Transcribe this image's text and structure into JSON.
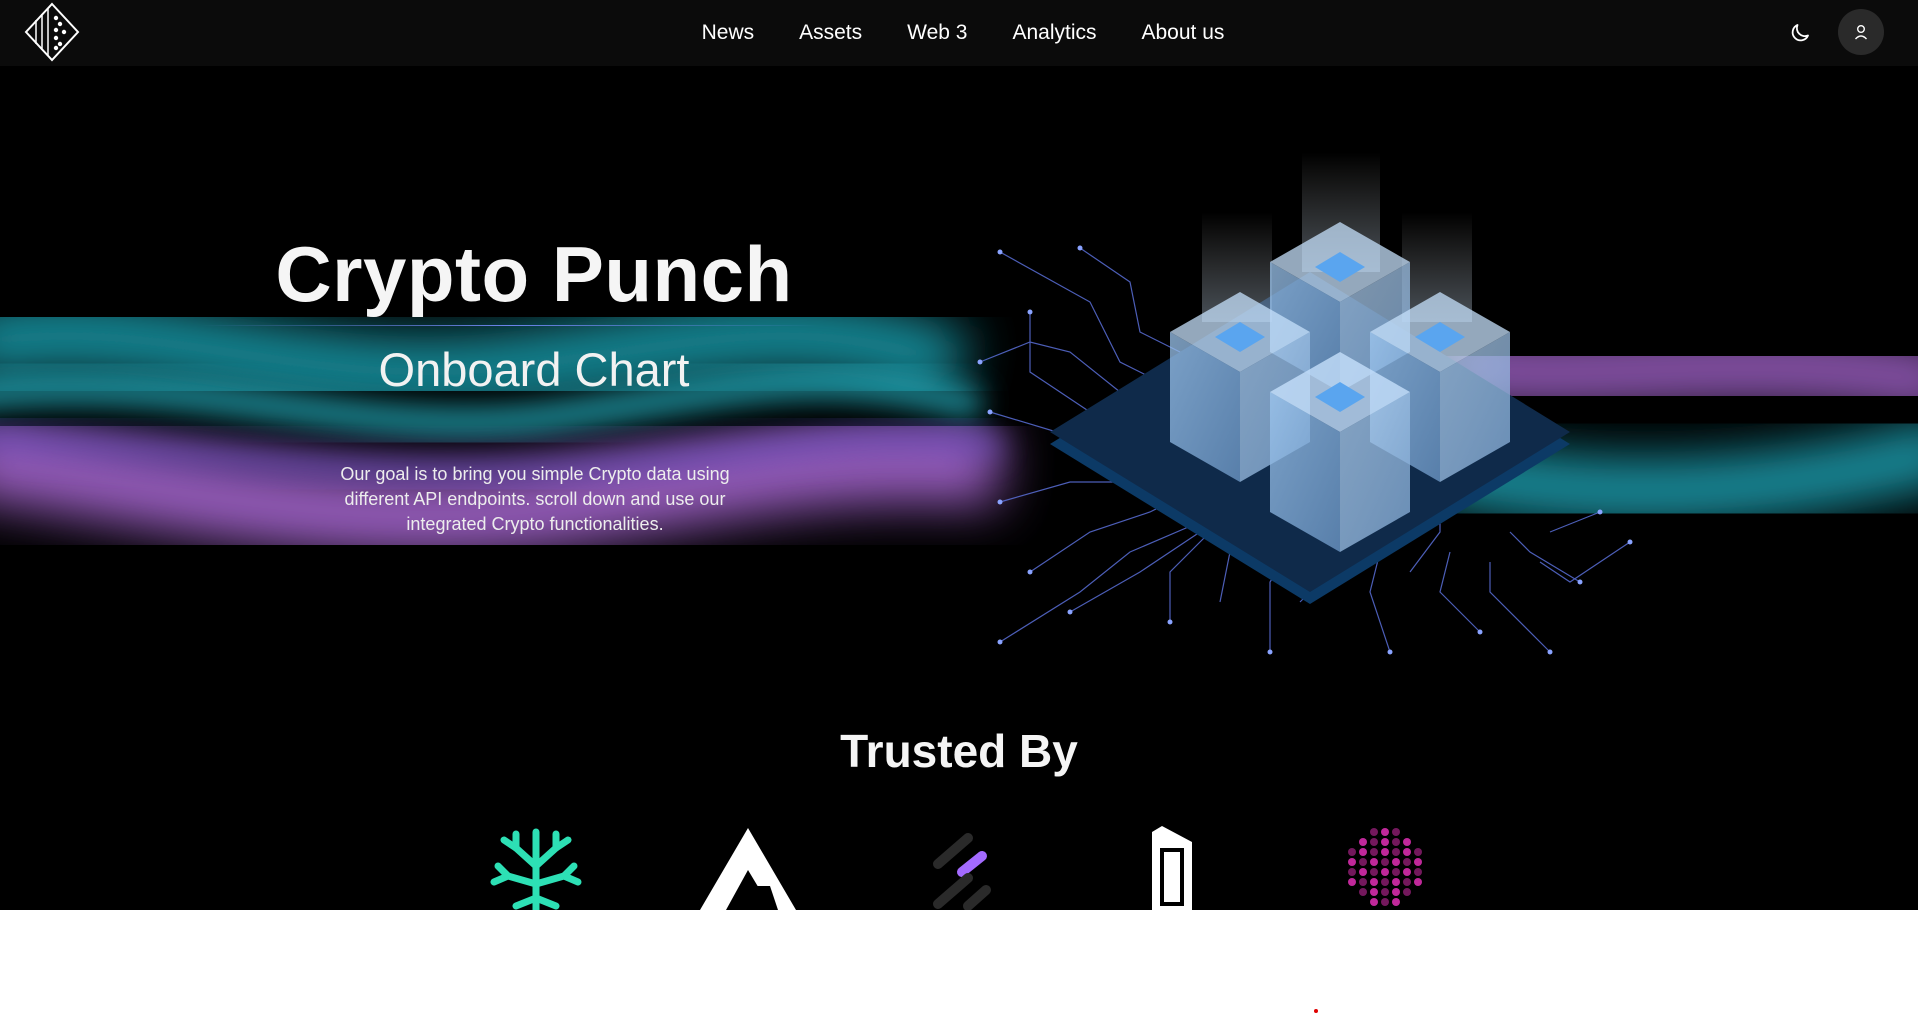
{
  "nav": {
    "items": [
      {
        "label": "News"
      },
      {
        "label": "Assets"
      },
      {
        "label": "Web 3"
      },
      {
        "label": "Analytics"
      },
      {
        "label": "About us"
      }
    ],
    "theme_icon": "moon-icon",
    "user_icon": "user-icon",
    "logo_icon": "diamond-logo-icon"
  },
  "hero": {
    "title": "Crypto Punch",
    "subtitle": "Onboard Chart",
    "description": "Our goal is to bring you simple Crypto data using different API endpoints. scroll down and use our integrated Crypto functionalities."
  },
  "trusted": {
    "heading": "Trusted By",
    "brands": [
      {
        "icon": "snowflake-tree-icon",
        "color": "#2de0b5"
      },
      {
        "icon": "mountain-a-icon",
        "color": "#ffffff"
      },
      {
        "icon": "slashes-icon",
        "color": "#a46bff"
      },
      {
        "icon": "book-card-icon",
        "color": "#ffffff"
      },
      {
        "icon": "hexagon-dots-icon",
        "color": "#c0289a"
      }
    ]
  },
  "colors": {
    "nav_bg": "#0b0b0b",
    "hero_bg": "#000000",
    "glow_cyan": "#1fb6c9",
    "glow_purple": "#b56ee0"
  }
}
